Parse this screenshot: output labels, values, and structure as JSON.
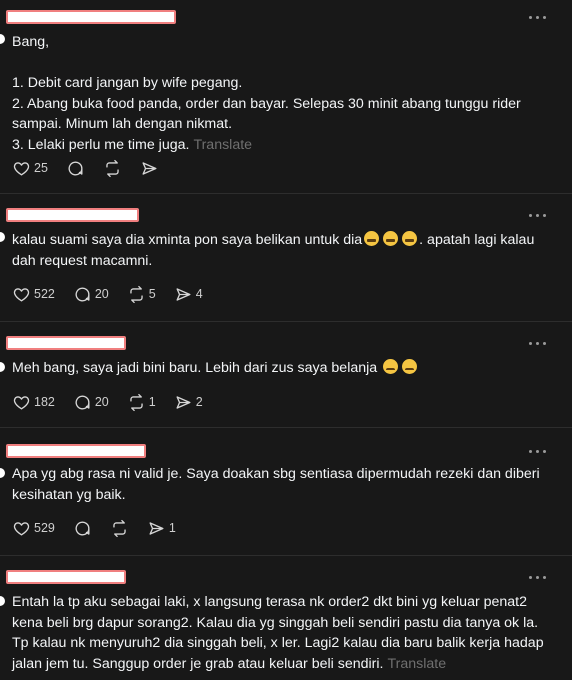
{
  "posts": [
    {
      "text": "Bang,\n\n1. Debit card jangan by wife pegang.\n2. Abang buka food panda, order dan bayar. Selepas 30 minit abang tunggu rider sampai. Minum lah dengan nikmat.\n3. Lelaki perlu me time juga.",
      "translate": "Translate",
      "likes": "25",
      "replies": "",
      "reposts": "",
      "shares": ""
    },
    {
      "text_before": "kalau suami saya dia xminta pon saya belikan untuk dia",
      "text_after": ". apatah lagi kalau dah request macamni.",
      "emoji": [
        "grin-icon",
        "grin-icon",
        "grin-icon"
      ],
      "likes": "522",
      "replies": "20",
      "reposts": "5",
      "shares": "4"
    },
    {
      "text_before": "Meh bang, saya jadi bini baru. Lebih dari zus saya belanja",
      "emoji": [
        "sad-face-icon",
        "sad-face-icon"
      ],
      "likes": "182",
      "replies": "20",
      "reposts": "1",
      "shares": "2"
    },
    {
      "text": "Apa yg abg rasa ni valid je. Saya doakan sbg sentiasa dipermudah rezeki dan diberi kesihatan yg baik.",
      "likes": "529",
      "replies": "",
      "reposts": "",
      "shares": "1"
    },
    {
      "text": "Entah la tp aku sebagai laki, x langsung terasa nk order2 dkt bini yg keluar penat2 kena beli brg dapur sorang2. Kalau dia yg singgah beli sendiri pastu dia tanya ok la. Tp kalau nk menyuruh2 dia singgah beli, x ler. Lagi2 kalau dia baru balik kerja hadap jalan jem tu. Sanggup order je grab atau keluar beli sendiri.",
      "translate": "Translate"
    }
  ],
  "colors": {
    "background": "#181818",
    "text": "#f3f5f7",
    "muted": "#6f6f6f",
    "redaction_border": "#f07f7f"
  }
}
